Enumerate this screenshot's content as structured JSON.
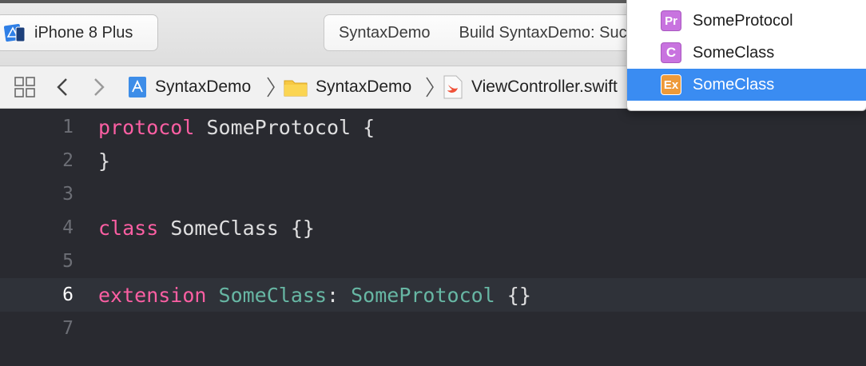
{
  "toolbar": {
    "scheme_label": "iPhone 8 Plus",
    "activity_project": "SyntaxDemo",
    "activity_status": "Build SyntaxDemo: Succeeded"
  },
  "jumpbar": {
    "crumbs": [
      "SyntaxDemo",
      "SyntaxDemo",
      "ViewController.swift"
    ]
  },
  "editor": {
    "current_line": 6,
    "lines": [
      {
        "num": "1",
        "tokens": [
          {
            "t": "protocol",
            "k": "kw"
          },
          {
            "t": " SomeProtocol {",
            "k": "plain"
          }
        ]
      },
      {
        "num": "2",
        "tokens": [
          {
            "t": "}",
            "k": "plain"
          }
        ]
      },
      {
        "num": "3",
        "tokens": []
      },
      {
        "num": "4",
        "tokens": [
          {
            "t": "class",
            "k": "kw"
          },
          {
            "t": " SomeClass {}",
            "k": "plain"
          }
        ]
      },
      {
        "num": "5",
        "tokens": []
      },
      {
        "num": "6",
        "tokens": [
          {
            "t": "extension",
            "k": "kw"
          },
          {
            "t": " ",
            "k": "plain"
          },
          {
            "t": "SomeClass",
            "k": "ext-type"
          },
          {
            "t": ": ",
            "k": "plain"
          },
          {
            "t": "SomeProtocol",
            "k": "ext-type"
          },
          {
            "t": " {}",
            "k": "plain"
          }
        ]
      },
      {
        "num": "7",
        "tokens": []
      }
    ]
  },
  "popup": {
    "items": [
      {
        "badge": "Pr",
        "label": "SomeProtocol",
        "selected": false
      },
      {
        "badge": "C",
        "label": "SomeClass",
        "selected": false
      },
      {
        "badge": "Ex",
        "label": "SomeClass",
        "selected": true
      }
    ]
  },
  "colors": {
    "keyword": "#fc5fa3",
    "type_ref": "#67b7a4",
    "editor_bg": "#292a30",
    "selection": "#3a8cf2"
  }
}
